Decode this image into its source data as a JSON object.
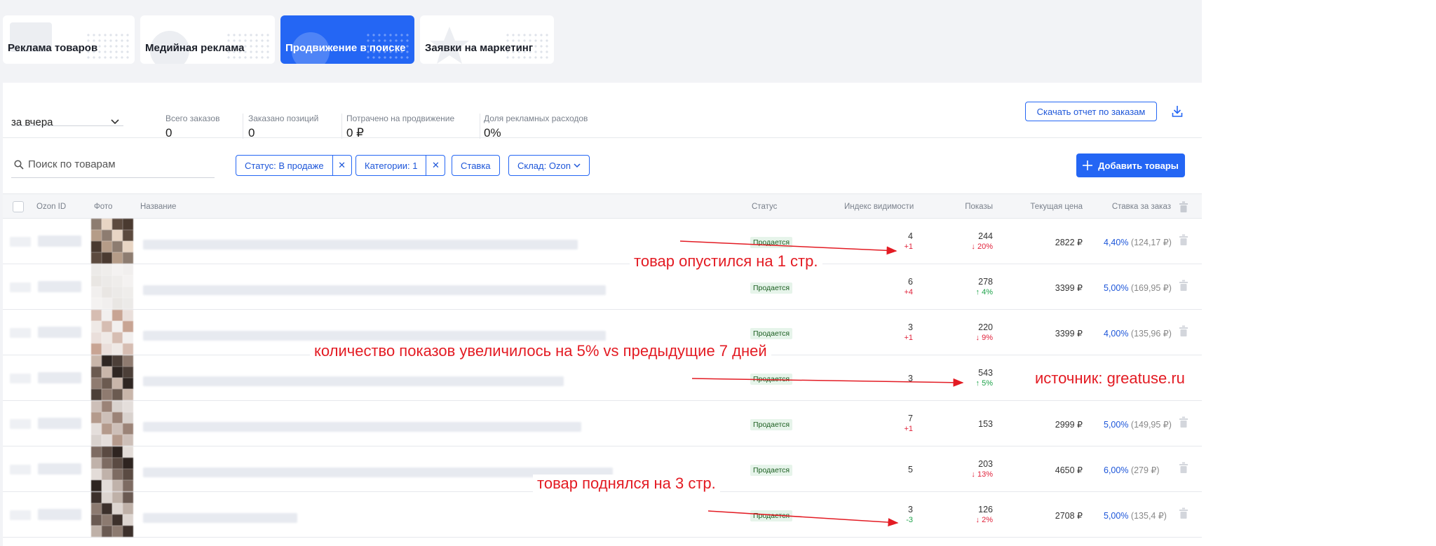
{
  "tabs": [
    {
      "label": "Реклама товаров",
      "active": false
    },
    {
      "label": "Медийная реклама",
      "active": false
    },
    {
      "label": "Продвижение в поиске",
      "active": true
    },
    {
      "label": "Заявки на маркетинг",
      "active": false
    }
  ],
  "period": {
    "value": "за вчера"
  },
  "stats": [
    {
      "label": "Всего заказов",
      "value": "0"
    },
    {
      "label": "Заказано позиций",
      "value": "0"
    },
    {
      "label": "Потрачено на продвижение",
      "value": "0 ₽"
    },
    {
      "label": "Доля рекламных расходов",
      "value": "0%"
    }
  ],
  "download_report_label": "Скачать отчет по заказам",
  "search": {
    "placeholder": "Поиск по товарам"
  },
  "filters": {
    "status": "Статус: В продаже",
    "categories": "Категории: 1",
    "bid": "Ставка",
    "warehouse": "Склад: Ozon"
  },
  "add_products_label": "Добавить товары",
  "columns": {
    "ozon_id": "Ozon ID",
    "photo": "Фото",
    "name": "Название",
    "status": "Статус",
    "visibility": "Индекс видимости",
    "shows": "Показы",
    "price": "Текущая цена",
    "bid": "Ставка за заказ"
  },
  "rows": [
    {
      "status": "Продается",
      "visibility": "4",
      "visibility_delta": "+1",
      "visibility_delta_color": "red",
      "shows": "244",
      "shows_delta": "↓ 20%",
      "shows_delta_color": "red",
      "price": "2822 ₽",
      "bid_pct": "4,40%",
      "bid_amount": "(124,17 ₽)"
    },
    {
      "status": "Продается",
      "visibility": "6",
      "visibility_delta": "+4",
      "visibility_delta_color": "red",
      "shows": "278",
      "shows_delta": "↑ 4%",
      "shows_delta_color": "green",
      "price": "3399 ₽",
      "bid_pct": "5,00%",
      "bid_amount": "(169,95 ₽)"
    },
    {
      "status": "Продается",
      "visibility": "3",
      "visibility_delta": "+1",
      "visibility_delta_color": "red",
      "shows": "220",
      "shows_delta": "↓ 9%",
      "shows_delta_color": "red",
      "price": "3399 ₽",
      "bid_pct": "4,00%",
      "bid_amount": "(135,96 ₽)"
    },
    {
      "status": "Продается",
      "visibility": "3",
      "visibility_delta": "",
      "visibility_delta_color": "red",
      "shows": "543",
      "shows_delta": "↑ 5%",
      "shows_delta_color": "green",
      "price": "",
      "bid_pct": "",
      "bid_amount": ""
    },
    {
      "status": "Продается",
      "visibility": "7",
      "visibility_delta": "+1",
      "visibility_delta_color": "red",
      "shows": "153",
      "shows_delta": "",
      "shows_delta_color": "red",
      "price": "2999 ₽",
      "bid_pct": "5,00%",
      "bid_amount": "(149,95 ₽)"
    },
    {
      "status": "Продается",
      "visibility": "5",
      "visibility_delta": "",
      "visibility_delta_color": "red",
      "shows": "203",
      "shows_delta": "↓ 13%",
      "shows_delta_color": "red",
      "price": "4650 ₽",
      "bid_pct": "6,00%",
      "bid_amount": "(279 ₽)"
    },
    {
      "status": "Продается",
      "visibility": "3",
      "visibility_delta": "-3",
      "visibility_delta_color": "green",
      "shows": "126",
      "shows_delta": "↓ 2%",
      "shows_delta_color": "red",
      "price": "2708 ₽",
      "bid_pct": "5,00%",
      "bid_amount": "(135,4 ₽)"
    }
  ],
  "annotations": {
    "dropped": "товар опустился на 1 стр.",
    "shows_increase": "количество показов увеличилось на 5% vs предыдущие 7 дней",
    "source": "источник: greatuse.ru",
    "rose": "товар поднялся на 3 стр."
  },
  "colors": {
    "accent": "#2466f4",
    "annotation": "#e31b23",
    "negative": "#e0213a",
    "positive": "#1ea34a"
  }
}
